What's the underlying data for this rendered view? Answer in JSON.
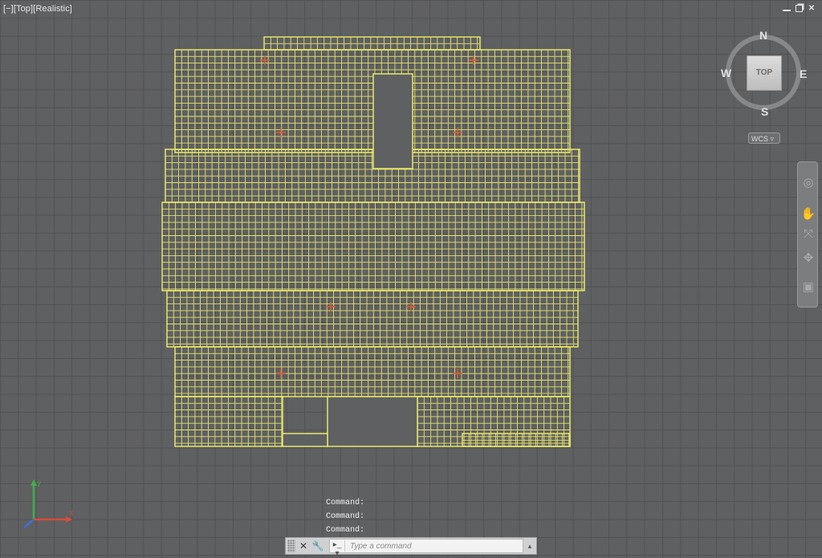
{
  "viewport": {
    "label": "[−][Top][Realistic]"
  },
  "window_controls": {
    "minimize": "",
    "restore": "",
    "close": "✕"
  },
  "colors": {
    "mesh": "#f0ef6a",
    "mesh_accent": "#e05a3a",
    "canvas_bg": "#5f6062",
    "grid": "#505052"
  },
  "viewcube": {
    "face": "TOP",
    "north": "N",
    "south": "S",
    "east": "E",
    "west": "W",
    "wcs": "WCS ▿"
  },
  "navbar": {
    "icons": [
      "steering-wheel-icon",
      "pan-icon",
      "zoom-extents-icon",
      "orbit-icon",
      "showmotion-icon"
    ]
  },
  "ucs": {
    "x_label": "X",
    "y_label": "Y"
  },
  "command": {
    "history": [
      "Command:",
      "Command:",
      "Command:"
    ],
    "placeholder": "Type a command",
    "close_glyph": "✕",
    "customize_glyph": "🔧",
    "prompt_glyph": "▸_ ▾"
  }
}
